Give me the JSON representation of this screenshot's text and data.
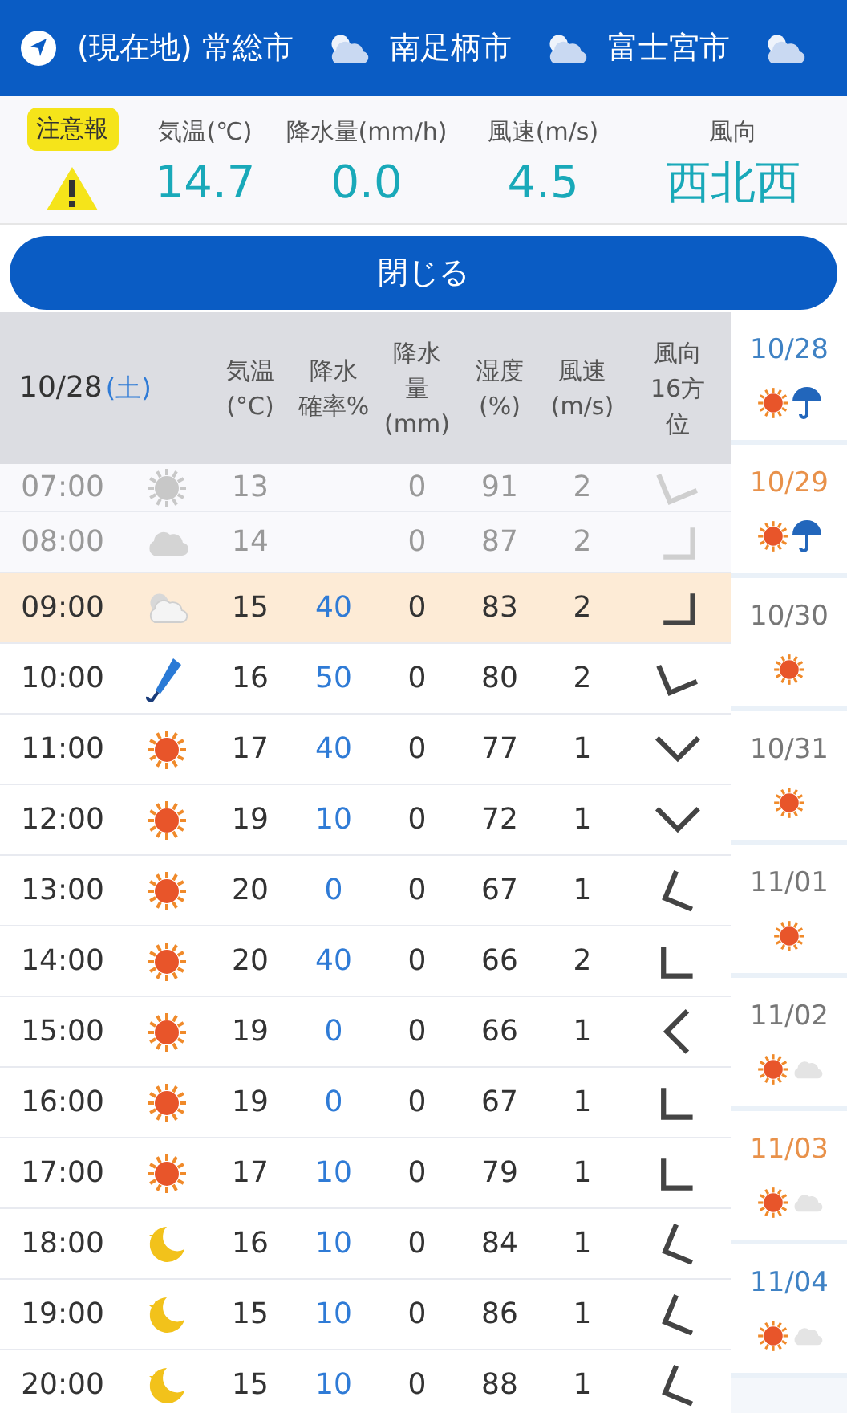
{
  "tabs": [
    {
      "kind": "location",
      "label": "(現在地) 常総市"
    },
    {
      "kind": "partly",
      "label": "南足柄市"
    },
    {
      "kind": "partly",
      "label": "富士宮市"
    },
    {
      "kind": "partly"
    }
  ],
  "current": {
    "badge": "注意報",
    "items": [
      {
        "label": "気温(℃)",
        "value": "14.7"
      },
      {
        "label": "降水量(mm/h)",
        "value": "0.0"
      },
      {
        "label": "風速(m/s)",
        "value": "4.5"
      },
      {
        "label": "風向",
        "value": "西北西"
      }
    ]
  },
  "close_button": "閉じる",
  "table": {
    "date": "10/28",
    "weekday": "(土)",
    "columns": [
      [
        "気温",
        "(°C)"
      ],
      [
        "降水",
        "確率%"
      ],
      [
        "降水",
        "量",
        "(mm)"
      ],
      [
        "湿度",
        "(%)"
      ],
      [
        "風速",
        "(m/s)"
      ],
      [
        "風向",
        "16方",
        "位"
      ]
    ],
    "rows": [
      {
        "time": "07:00",
        "kind": "sun",
        "temp": "13",
        "amount": "0",
        "humidity": "91",
        "speed": "2",
        "wind_arrow": {
          "kind": "nnw"
        },
        "past": true,
        "selected": false
      },
      {
        "time": "08:00",
        "kind": "cloud",
        "temp": "14",
        "amount": "0",
        "humidity": "87",
        "speed": "2",
        "wind_arrow": {
          "kind": "ne"
        },
        "past": true,
        "selected": false
      },
      {
        "time": "09:00",
        "kind": "partly",
        "temp": "15",
        "prob": "40",
        "amount": "0",
        "humidity": "83",
        "speed": "2",
        "wind_arrow": {
          "kind": "ne"
        },
        "past": false,
        "selected": true
      },
      {
        "time": "10:00",
        "kind": "umbrella",
        "temp": "16",
        "prob": "50",
        "amount": "0",
        "humidity": "80",
        "speed": "2",
        "wind_arrow": {
          "kind": "nnw"
        },
        "past": false,
        "selected": false
      },
      {
        "time": "11:00",
        "kind": "sun",
        "temp": "17",
        "prob": "40",
        "amount": "0",
        "humidity": "77",
        "speed": "1",
        "wind_arrow": {
          "kind": "n"
        },
        "past": false,
        "selected": false
      },
      {
        "time": "12:00",
        "kind": "sun",
        "temp": "19",
        "prob": "10",
        "amount": "0",
        "humidity": "72",
        "speed": "1",
        "wind_arrow": {
          "kind": "n"
        },
        "past": false,
        "selected": false
      },
      {
        "time": "13:00",
        "kind": "sun",
        "temp": "20",
        "prob": "0",
        "amount": "0",
        "humidity": "67",
        "speed": "1",
        "wind_arrow": {
          "kind": "wnw"
        },
        "past": false,
        "selected": false
      },
      {
        "time": "14:00",
        "kind": "sun",
        "temp": "20",
        "prob": "40",
        "amount": "0",
        "humidity": "66",
        "speed": "2",
        "wind_arrow": {
          "kind": "nw"
        },
        "past": false,
        "selected": false
      },
      {
        "time": "15:00",
        "kind": "sun",
        "temp": "19",
        "prob": "0",
        "amount": "0",
        "humidity": "66",
        "speed": "1",
        "wind_arrow": {
          "kind": "w"
        },
        "past": false,
        "selected": false
      },
      {
        "time": "16:00",
        "kind": "sun",
        "temp": "19",
        "prob": "0",
        "amount": "0",
        "humidity": "67",
        "speed": "1",
        "wind_arrow": {
          "kind": "nw"
        },
        "past": false,
        "selected": false
      },
      {
        "time": "17:00",
        "kind": "sun",
        "temp": "17",
        "prob": "10",
        "amount": "0",
        "humidity": "79",
        "speed": "1",
        "wind_arrow": {
          "kind": "nw"
        },
        "past": false,
        "selected": false
      },
      {
        "time": "18:00",
        "kind": "moon",
        "temp": "16",
        "prob": "10",
        "amount": "0",
        "humidity": "84",
        "speed": "1",
        "wind_arrow": {
          "kind": "wnw"
        },
        "past": false,
        "selected": false
      },
      {
        "time": "19:00",
        "kind": "moon",
        "temp": "15",
        "prob": "10",
        "amount": "0",
        "humidity": "86",
        "speed": "1",
        "wind_arrow": {
          "kind": "wnw"
        },
        "past": false,
        "selected": false
      },
      {
        "time": "20:00",
        "kind": "moon",
        "temp": "15",
        "prob": "10",
        "amount": "0",
        "humidity": "88",
        "speed": "1",
        "wind_arrow": {
          "kind": "wnw"
        },
        "past": false,
        "selected": false
      }
    ]
  },
  "days": [
    {
      "date": "10/28",
      "color": "#3f82c4",
      "icons": [
        {
          "kind": "sun"
        },
        {
          "kind": "rain"
        }
      ]
    },
    {
      "date": "10/29",
      "color": "#e8914a",
      "icons": [
        {
          "kind": "sun"
        },
        {
          "kind": "rain"
        }
      ]
    },
    {
      "date": "10/30",
      "color": "#777777",
      "icons": [
        {
          "kind": "sun"
        }
      ]
    },
    {
      "date": "10/31",
      "color": "#777777",
      "icons": [
        {
          "kind": "sun"
        }
      ]
    },
    {
      "date": "11/01",
      "color": "#777777",
      "icons": [
        {
          "kind": "sun"
        }
      ]
    },
    {
      "date": "11/02",
      "color": "#777777",
      "icons": [
        {
          "kind": "sun"
        },
        {
          "kind": "cloud"
        }
      ]
    },
    {
      "date": "11/03",
      "color": "#e8914a",
      "icons": [
        {
          "kind": "sun"
        },
        {
          "kind": "cloud"
        }
      ]
    },
    {
      "date": "11/04",
      "color": "#3f82c4",
      "icons": [
        {
          "kind": "sun"
        },
        {
          "kind": "cloud"
        }
      ]
    }
  ]
}
